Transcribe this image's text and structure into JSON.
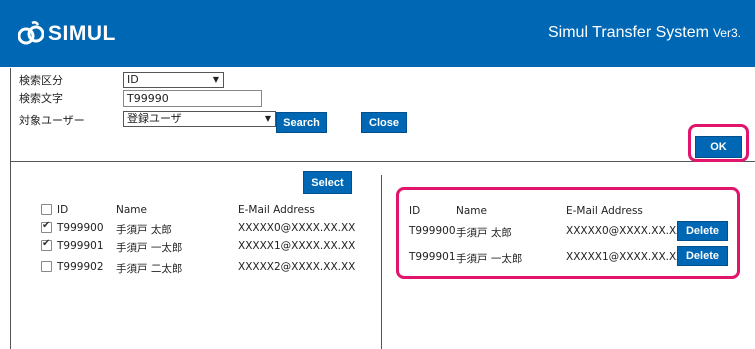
{
  "header": {
    "logo_text": "SIMUL",
    "system_name": "Simul Transfer System",
    "version": "Ver3."
  },
  "search": {
    "category_label": "検索区分",
    "category_value": "ID",
    "text_label": "検索文字",
    "text_value": "T99990",
    "target_label": "対象ユーザー",
    "target_value": "登録ユーザ",
    "search_button": "Search",
    "close_button": "Close",
    "ok_button": "OK"
  },
  "left_list": {
    "select_button": "Select",
    "columns": {
      "id": "ID",
      "name": "Name",
      "email": "E-Mail Address"
    },
    "rows": [
      {
        "checked": true,
        "id": "T999900",
        "name": "手須戸 太郎",
        "email": "XXXXX0@XXXX.XX.XX"
      },
      {
        "checked": true,
        "id": "T999901",
        "name": "手須戸 一太郎",
        "email": "XXXXX1@XXXX.XX.XX"
      },
      {
        "checked": false,
        "id": "T999902",
        "name": "手須戸 二太郎",
        "email": "XXXXX2@XXXX.XX.XX"
      }
    ]
  },
  "right_list": {
    "columns": {
      "id": "ID",
      "name": "Name",
      "email": "E-Mail Address"
    },
    "delete_label": "Delete",
    "rows": [
      {
        "id": "T999900",
        "name": "手須戸 太郎",
        "email": "XXXXX0@XXXX.XX.XX"
      },
      {
        "id": "T999901",
        "name": "手須戸 一太郎",
        "email": "XXXXX1@XXXX.XX.XX"
      }
    ]
  },
  "colors": {
    "brand": "#0067b4",
    "highlight": "#e0156b"
  }
}
